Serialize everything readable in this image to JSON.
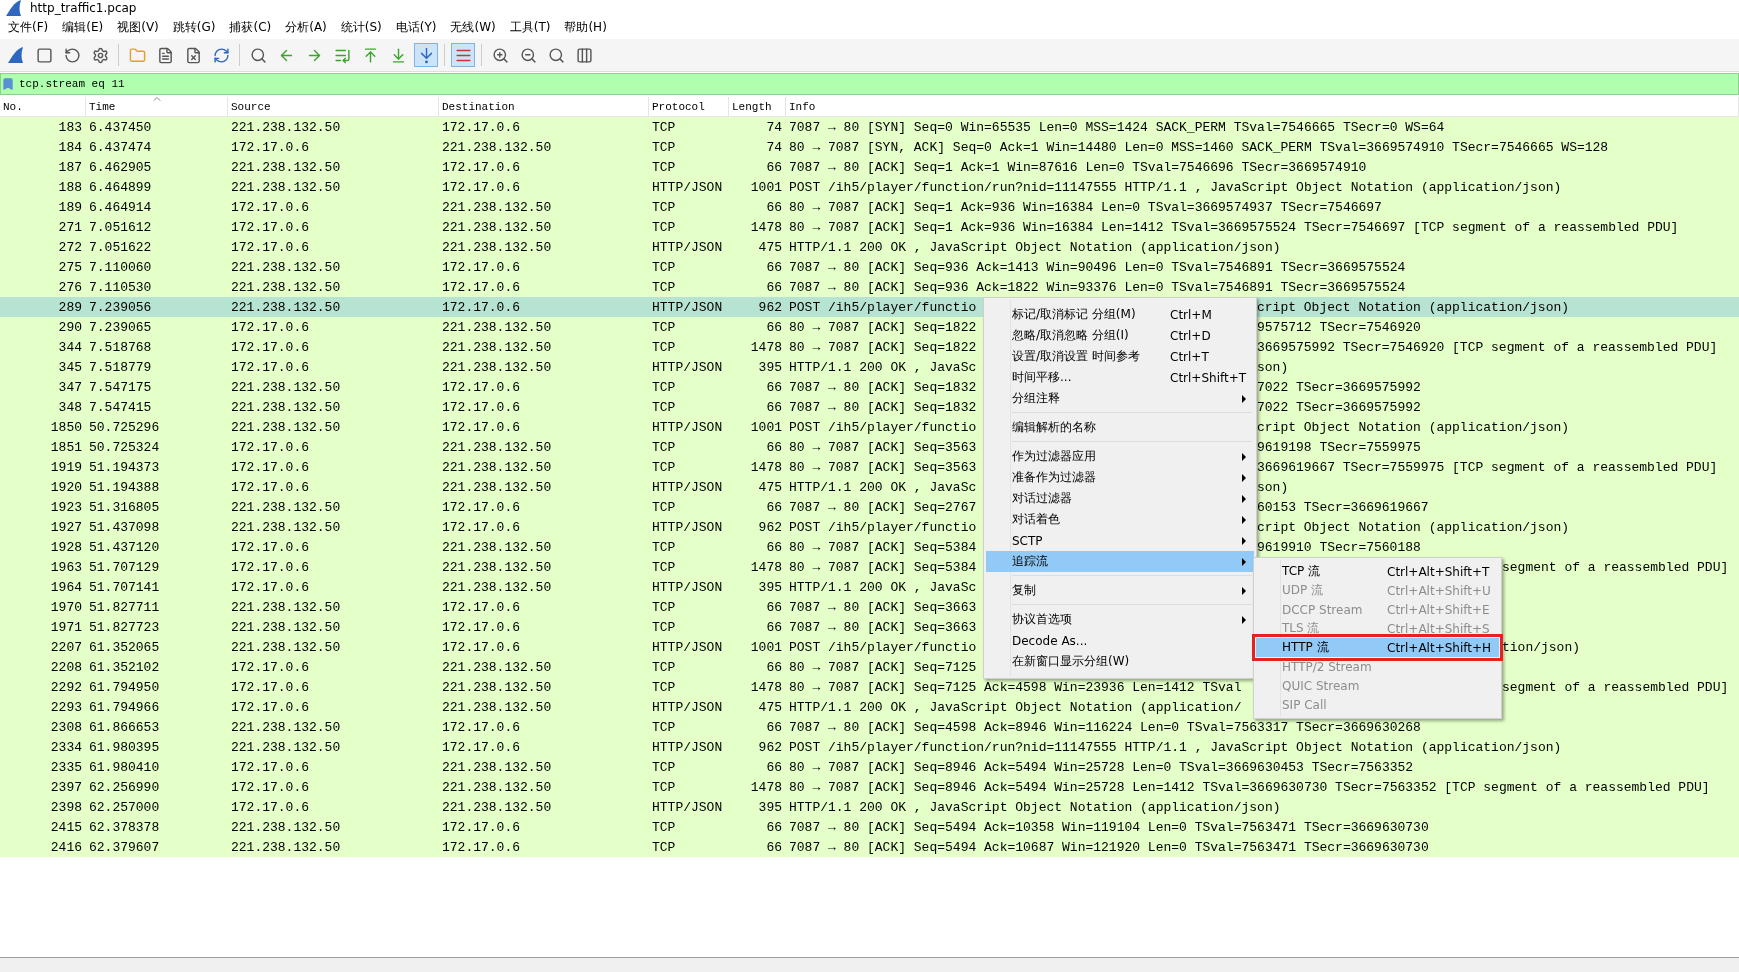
{
  "window": {
    "title": "http_traffic1.pcap"
  },
  "menu_bar": [
    "文件(F)",
    "编辑(E)",
    "视图(V)",
    "跳转(G)",
    "捕获(C)",
    "分析(A)",
    "统计(S)",
    "电话(Y)",
    "无线(W)",
    "工具(T)",
    "帮助(H)"
  ],
  "toolbar": [
    {
      "kind": "start",
      "pressed": false
    },
    {
      "kind": "stop",
      "pressed": false
    },
    {
      "kind": "restart",
      "pressed": false
    },
    {
      "kind": "options",
      "pressed": false
    },
    {
      "kind": "separator"
    },
    {
      "kind": "open",
      "pressed": false
    },
    {
      "kind": "save",
      "pressed": false
    },
    {
      "kind": "close",
      "pressed": false
    },
    {
      "kind": "reload",
      "pressed": false
    },
    {
      "kind": "separator"
    },
    {
      "kind": "find",
      "pressed": false
    },
    {
      "kind": "back",
      "pressed": false
    },
    {
      "kind": "forward",
      "pressed": false
    },
    {
      "kind": "goto",
      "pressed": false
    },
    {
      "kind": "first",
      "pressed": false
    },
    {
      "kind": "last",
      "pressed": false
    },
    {
      "kind": "autoscroll",
      "pressed": true
    },
    {
      "kind": "separator"
    },
    {
      "kind": "colorize",
      "pressed": true
    },
    {
      "kind": "separator"
    },
    {
      "kind": "zoom_in",
      "pressed": false
    },
    {
      "kind": "zoom_out",
      "pressed": false
    },
    {
      "kind": "zoom_reset",
      "pressed": false
    },
    {
      "kind": "resize_columns",
      "pressed": false
    }
  ],
  "filter": {
    "value": "tcp.stream eq 11"
  },
  "columns": [
    {
      "label": "No.",
      "sorted": false
    },
    {
      "label": "Time",
      "sorted": true
    },
    {
      "label": "Source",
      "sorted": false
    },
    {
      "label": "Destination",
      "sorted": false
    },
    {
      "label": "Protocol",
      "sorted": false
    },
    {
      "label": "Length",
      "sorted": false
    },
    {
      "label": "Info",
      "sorted": false
    }
  ],
  "rows": [
    {
      "no": "183",
      "time": "6.437450",
      "source": "221.238.132.50",
      "destination": "172.17.0.6",
      "protocol": "TCP",
      "length": "74",
      "info": "7087 → 80 [SYN] Seq=0 Win=65535 Len=0 MSS=1424 SACK_PERM TSval=7546665 TSecr=0 WS=64",
      "selected": false
    },
    {
      "no": "184",
      "time": "6.437474",
      "source": "172.17.0.6",
      "destination": "221.238.132.50",
      "protocol": "TCP",
      "length": "74",
      "info": "80 → 7087 [SYN, ACK] Seq=0 Ack=1 Win=14480 Len=0 MSS=1460 SACK_PERM TSval=3669574910 TSecr=7546665 WS=128",
      "selected": false
    },
    {
      "no": "187",
      "time": "6.462905",
      "source": "221.238.132.50",
      "destination": "172.17.0.6",
      "protocol": "TCP",
      "length": "66",
      "info": "7087 → 80 [ACK] Seq=1 Ack=1 Win=87616 Len=0 TSval=7546696 TSecr=3669574910",
      "selected": false
    },
    {
      "no": "188",
      "time": "6.464899",
      "source": "221.238.132.50",
      "destination": "172.17.0.6",
      "protocol": "HTTP/JSON",
      "length": "1001",
      "info": "POST /ih5/player/function/run?nid=11147555 HTTP/1.1 , JavaScript Object Notation (application/json)",
      "selected": false
    },
    {
      "no": "189",
      "time": "6.464914",
      "source": "172.17.0.6",
      "destination": "221.238.132.50",
      "protocol": "TCP",
      "length": "66",
      "info": "80 → 7087 [ACK] Seq=1 Ack=936 Win=16384 Len=0 TSval=3669574937 TSecr=7546697",
      "selected": false
    },
    {
      "no": "271",
      "time": "7.051612",
      "source": "172.17.0.6",
      "destination": "221.238.132.50",
      "protocol": "TCP",
      "length": "1478",
      "info": "80 → 7087 [ACK] Seq=1 Ack=936 Win=16384 Len=1412 TSval=3669575524 TSecr=7546697 [TCP segment of a reassembled PDU]",
      "selected": false
    },
    {
      "no": "272",
      "time": "7.051622",
      "source": "172.17.0.6",
      "destination": "221.238.132.50",
      "protocol": "HTTP/JSON",
      "length": "475",
      "info": "HTTP/1.1 200 OK , JavaScript Object Notation (application/json)",
      "selected": false
    },
    {
      "no": "275",
      "time": "7.110060",
      "source": "221.238.132.50",
      "destination": "172.17.0.6",
      "protocol": "TCP",
      "length": "66",
      "info": "7087 → 80 [ACK] Seq=936 Ack=1413 Win=90496 Len=0 TSval=7546891 TSecr=3669575524",
      "selected": false
    },
    {
      "no": "276",
      "time": "7.110530",
      "source": "221.238.132.50",
      "destination": "172.17.0.6",
      "protocol": "TCP",
      "length": "66",
      "info": "7087 → 80 [ACK] Seq=936 Ack=1822 Win=93376 Len=0 TSval=7546891 TSecr=3669575524",
      "selected": false
    },
    {
      "no": "289",
      "time": "7.239056",
      "source": "221.238.132.50",
      "destination": "172.17.0.6",
      "protocol": "HTTP/JSON",
      "length": "962",
      "info": "POST /ih5/player/functio",
      "info_tail": "cript Object Notation (application/json)",
      "kind": "under_menu",
      "selected": true
    },
    {
      "no": "290",
      "time": "7.239065",
      "source": "172.17.0.6",
      "destination": "221.238.132.50",
      "protocol": "TCP",
      "length": "66",
      "info": "80 → 7087 [ACK] Seq=1822",
      "info_tail": "9575712 TSecr=7546920",
      "kind": "under_menu",
      "selected": false
    },
    {
      "no": "344",
      "time": "7.518768",
      "source": "172.17.0.6",
      "destination": "221.238.132.50",
      "protocol": "TCP",
      "length": "1478",
      "info": "80 → 7087 [ACK] Seq=1822",
      "info_tail": "3669575992 TSecr=7546920 [TCP segment of a reassembled PDU]",
      "kind": "under_menu",
      "selected": false
    },
    {
      "no": "345",
      "time": "7.518779",
      "source": "172.17.0.6",
      "destination": "221.238.132.50",
      "protocol": "HTTP/JSON",
      "length": "395",
      "info": "HTTP/1.1 200 OK , JavaSc",
      "info_tail": "son)",
      "kind": "under_menu",
      "selected": false
    },
    {
      "no": "347",
      "time": "7.547175",
      "source": "221.238.132.50",
      "destination": "172.17.0.6",
      "protocol": "TCP",
      "length": "66",
      "info": "7087 → 80 [ACK] Seq=1832",
      "info_tail": "7022 TSecr=3669575992",
      "kind": "under_menu",
      "selected": false
    },
    {
      "no": "348",
      "time": "7.547415",
      "source": "221.238.132.50",
      "destination": "172.17.0.6",
      "protocol": "TCP",
      "length": "66",
      "info": "7087 → 80 [ACK] Seq=1832",
      "info_tail": "7022 TSecr=3669575992",
      "kind": "under_menu",
      "selected": false
    },
    {
      "no": "1850",
      "time": "50.725296",
      "source": "221.238.132.50",
      "destination": "172.17.0.6",
      "protocol": "HTTP/JSON",
      "length": "1001",
      "info": "POST /ih5/player/functio",
      "info_tail": "cript Object Notation (application/json)",
      "kind": "under_menu",
      "selected": false
    },
    {
      "no": "1851",
      "time": "50.725324",
      "source": "172.17.0.6",
      "destination": "221.238.132.50",
      "protocol": "TCP",
      "length": "66",
      "info": "80 → 7087 [ACK] Seq=3563",
      "info_tail": "9619198 TSecr=7559975",
      "kind": "under_menu",
      "selected": false
    },
    {
      "no": "1919",
      "time": "51.194373",
      "source": "172.17.0.6",
      "destination": "221.238.132.50",
      "protocol": "TCP",
      "length": "1478",
      "info": "80 → 7087 [ACK] Seq=3563",
      "info_tail": "3669619667 TSecr=7559975 [TCP segment of a reassembled PDU]",
      "kind": "under_menu",
      "selected": false
    },
    {
      "no": "1920",
      "time": "51.194388",
      "source": "172.17.0.6",
      "destination": "221.238.132.50",
      "protocol": "HTTP/JSON",
      "length": "475",
      "info": "HTTP/1.1 200 OK , JavaSc",
      "info_tail": "son)",
      "kind": "under_menu",
      "selected": false
    },
    {
      "no": "1923",
      "time": "51.316805",
      "source": "221.238.132.50",
      "destination": "172.17.0.6",
      "protocol": "TCP",
      "length": "66",
      "info": "7087 → 80 [ACK] Seq=2767",
      "info_tail": "60153 TSecr=3669619667",
      "kind": "under_menu",
      "selected": false
    },
    {
      "no": "1927",
      "time": "51.437098",
      "source": "221.238.132.50",
      "destination": "172.17.0.6",
      "protocol": "HTTP/JSON",
      "length": "962",
      "info": "POST /ih5/player/functio",
      "info_tail": "cript Object Notation (application/json)",
      "kind": "under_menu",
      "selected": false
    },
    {
      "no": "1928",
      "time": "51.437120",
      "source": "172.17.0.6",
      "destination": "221.238.132.50",
      "protocol": "TCP",
      "length": "66",
      "info": "80 → 7087 [ACK] Seq=5384",
      "info_tail": "9619910 TSecr=7560188",
      "kind": "under_menu",
      "selected": false
    },
    {
      "no": "1963",
      "time": "51.707129",
      "source": "172.17.0.6",
      "destination": "221.238.132.50",
      "protocol": "TCP",
      "length": "1478",
      "info": "80 → 7087 [ACK] Seq=5384",
      "info_tail": "segment of a reassembled PDU]",
      "kind": "under_submenu",
      "selected": false
    },
    {
      "no": "1964",
      "time": "51.707141",
      "source": "172.17.0.6",
      "destination": "221.238.132.50",
      "protocol": "HTTP/JSON",
      "length": "395",
      "info": "HTTP/1.1 200 OK , JavaSc",
      "kind": "under_submenu",
      "selected": false
    },
    {
      "no": "1970",
      "time": "51.827711",
      "source": "221.238.132.50",
      "destination": "172.17.0.6",
      "protocol": "TCP",
      "length": "66",
      "info": "7087 → 80 [ACK] Seq=3663",
      "kind": "under_submenu",
      "selected": false
    },
    {
      "no": "1971",
      "time": "51.827723",
      "source": "221.238.132.50",
      "destination": "172.17.0.6",
      "protocol": "TCP",
      "length": "66",
      "info": "7087 → 80 [ACK] Seq=3663",
      "kind": "under_submenu",
      "selected": false
    },
    {
      "no": "2207",
      "time": "61.352065",
      "source": "221.238.132.50",
      "destination": "172.17.0.6",
      "protocol": "HTTP/JSON",
      "length": "1001",
      "info": "POST /ih5/player/functio",
      "info_tail": "tion/json)",
      "kind": "under_submenu",
      "selected": false
    },
    {
      "no": "2208",
      "time": "61.352102",
      "source": "172.17.0.6",
      "destination": "221.238.132.50",
      "protocol": "TCP",
      "length": "66",
      "info": "80 → 7087 [ACK] Seq=7125",
      "kind": "under_submenu",
      "selected": false
    },
    {
      "no": "2292",
      "time": "61.794950",
      "source": "172.17.0.6",
      "destination": "221.238.132.50",
      "protocol": "TCP",
      "length": "1478",
      "info": "80 → 7087 [ACK] Seq=7125 Ack=4598 Win=23936 Len=1412 TSval",
      "info_tail": "segment of a reassembled PDU]",
      "kind": "under_submenu",
      "selected": false
    },
    {
      "no": "2293",
      "time": "61.794966",
      "source": "172.17.0.6",
      "destination": "221.238.132.50",
      "protocol": "HTTP/JSON",
      "length": "475",
      "info": "HTTP/1.1 200 OK , JavaScript Object Notation (application/",
      "kind": "under_submenu",
      "selected": false
    },
    {
      "no": "2308",
      "time": "61.866653",
      "source": "221.238.132.50",
      "destination": "172.17.0.6",
      "protocol": "TCP",
      "length": "66",
      "info": "7087 → 80 [ACK] Seq=4598 Ack=8946 Win=116224 Len=0 TSval=7563317 TSecr=3669630268",
      "selected": false
    },
    {
      "no": "2334",
      "time": "61.980395",
      "source": "221.238.132.50",
      "destination": "172.17.0.6",
      "protocol": "HTTP/JSON",
      "length": "962",
      "info": "POST /ih5/player/function/run?nid=11147555 HTTP/1.1 , JavaScript Object Notation (application/json)",
      "selected": false
    },
    {
      "no": "2335",
      "time": "61.980410",
      "source": "172.17.0.6",
      "destination": "221.238.132.50",
      "protocol": "TCP",
      "length": "66",
      "info": "80 → 7087 [ACK] Seq=8946 Ack=5494 Win=25728 Len=0 TSval=3669630453 TSecr=7563352",
      "selected": false
    },
    {
      "no": "2397",
      "time": "62.256990",
      "source": "172.17.0.6",
      "destination": "221.238.132.50",
      "protocol": "TCP",
      "length": "1478",
      "info": "80 → 7087 [ACK] Seq=8946 Ack=5494 Win=25728 Len=1412 TSval=3669630730 TSecr=7563352 [TCP segment of a reassembled PDU]",
      "selected": false
    },
    {
      "no": "2398",
      "time": "62.257000",
      "source": "172.17.0.6",
      "destination": "221.238.132.50",
      "protocol": "HTTP/JSON",
      "length": "395",
      "info": "HTTP/1.1 200 OK , JavaScript Object Notation (application/json)",
      "selected": false
    },
    {
      "no": "2415",
      "time": "62.378378",
      "source": "221.238.132.50",
      "destination": "172.17.0.6",
      "protocol": "TCP",
      "length": "66",
      "info": "7087 → 80 [ACK] Seq=5494 Ack=10358 Win=119104 Len=0 TSval=7563471 TSecr=3669630730",
      "selected": false
    },
    {
      "no": "2416",
      "time": "62.379607",
      "source": "221.238.132.50",
      "destination": "172.17.0.6",
      "protocol": "TCP",
      "length": "66",
      "info": "7087 → 80 [ACK] Seq=5494 Ack=10687 Win=121920 Len=0 TSval=7563471 TSecr=3669630730",
      "selected": false
    }
  ],
  "context_menu": {
    "items": [
      {
        "kind": "item",
        "label": "标记/取消标记 分组(M)",
        "shortcut": "Ctrl+M",
        "has_submenu": false,
        "selected": false
      },
      {
        "kind": "item",
        "label": "忽略/取消忽略 分组(I)",
        "shortcut": "Ctrl+D",
        "has_submenu": false,
        "selected": false
      },
      {
        "kind": "item",
        "label": "设置/取消设置 时间参考",
        "shortcut": "Ctrl+T",
        "has_submenu": false,
        "selected": false
      },
      {
        "kind": "item",
        "label": "时间平移...",
        "shortcut": "Ctrl+Shift+T",
        "has_submenu": false,
        "selected": false
      },
      {
        "kind": "item",
        "label": "分组注释",
        "has_submenu": true,
        "selected": false
      },
      {
        "kind": "separator"
      },
      {
        "kind": "item",
        "label": "编辑解析的名称",
        "has_submenu": false,
        "selected": false
      },
      {
        "kind": "separator"
      },
      {
        "kind": "item",
        "label": "作为过滤器应用",
        "has_submenu": true,
        "selected": false
      },
      {
        "kind": "item",
        "label": "准备作为过滤器",
        "has_submenu": true,
        "selected": false
      },
      {
        "kind": "item",
        "label": "对话过滤器",
        "has_submenu": true,
        "selected": false
      },
      {
        "kind": "item",
        "label": "对话着色",
        "has_submenu": true,
        "selected": false
      },
      {
        "kind": "item",
        "label": "SCTP",
        "has_submenu": true,
        "selected": false
      },
      {
        "kind": "item",
        "label": "追踪流",
        "has_submenu": true,
        "selected": true
      },
      {
        "kind": "separator"
      },
      {
        "kind": "item",
        "label": "复制",
        "has_submenu": true,
        "selected": false
      },
      {
        "kind": "separator"
      },
      {
        "kind": "item",
        "label": "协议首选项",
        "has_submenu": true,
        "selected": false
      },
      {
        "kind": "item",
        "label": "Decode As...",
        "has_submenu": false,
        "selected": false
      },
      {
        "kind": "item",
        "label": "在新窗口显示分组(W)",
        "has_submenu": false,
        "selected": false
      }
    ]
  },
  "follow_submenu": {
    "items": [
      {
        "label": "TCP 流",
        "shortcut": "Ctrl+Alt+Shift+T",
        "disabled": false,
        "selected": false,
        "boxed": false
      },
      {
        "label": "UDP 流",
        "shortcut": "Ctrl+Alt+Shift+U",
        "disabled": true,
        "selected": false,
        "boxed": false
      },
      {
        "label": "DCCP Stream",
        "shortcut": "Ctrl+Alt+Shift+E",
        "disabled": true,
        "selected": false,
        "boxed": false
      },
      {
        "label": "TLS 流",
        "shortcut": "Ctrl+Alt+Shift+S",
        "disabled": true,
        "selected": false,
        "boxed": false
      },
      {
        "label": "HTTP 流",
        "shortcut": "Ctrl+Alt+Shift+H",
        "disabled": false,
        "selected": true,
        "boxed": true
      },
      {
        "label": "HTTP/2 Stream",
        "disabled": true,
        "selected": false,
        "boxed": false
      },
      {
        "label": "QUIC Stream",
        "disabled": true,
        "selected": false,
        "boxed": false
      },
      {
        "label": "SIP Call",
        "disabled": true,
        "selected": false,
        "boxed": false
      }
    ]
  }
}
